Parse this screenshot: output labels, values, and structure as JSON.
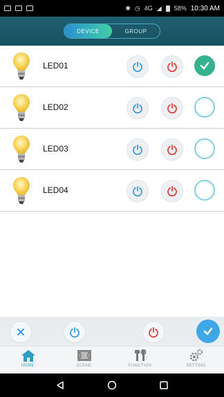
{
  "status_bar": {
    "left_icons": [
      "picture-icon",
      "mail-icon",
      "mail-icon"
    ],
    "network": "4G",
    "battery": "58%",
    "time": "10:30 AM"
  },
  "header": {
    "tabs": [
      {
        "label": "DEVICE",
        "active": true
      },
      {
        "label": "GROUP",
        "active": false
      }
    ]
  },
  "devices": [
    {
      "label": "LED01",
      "selected": true
    },
    {
      "label": "LED02",
      "selected": false
    },
    {
      "label": "LED03",
      "selected": false
    },
    {
      "label": "LED04",
      "selected": false
    }
  ],
  "bottom_tabs": [
    {
      "label": "HOME",
      "icon": "home-icon",
      "active": true
    },
    {
      "label": "SCENE",
      "icon": "scene-icon",
      "active": false
    },
    {
      "label": "FUNCTION",
      "icon": "function-icon",
      "active": false
    },
    {
      "label": "SETTING",
      "icon": "gear-icon",
      "active": false
    }
  ],
  "colors": {
    "header": "#1f5f73",
    "power_on": "#3b9be0",
    "power_off": "#e0403a",
    "selected_check": "#35b38f",
    "confirm": "#3fa7e6"
  }
}
